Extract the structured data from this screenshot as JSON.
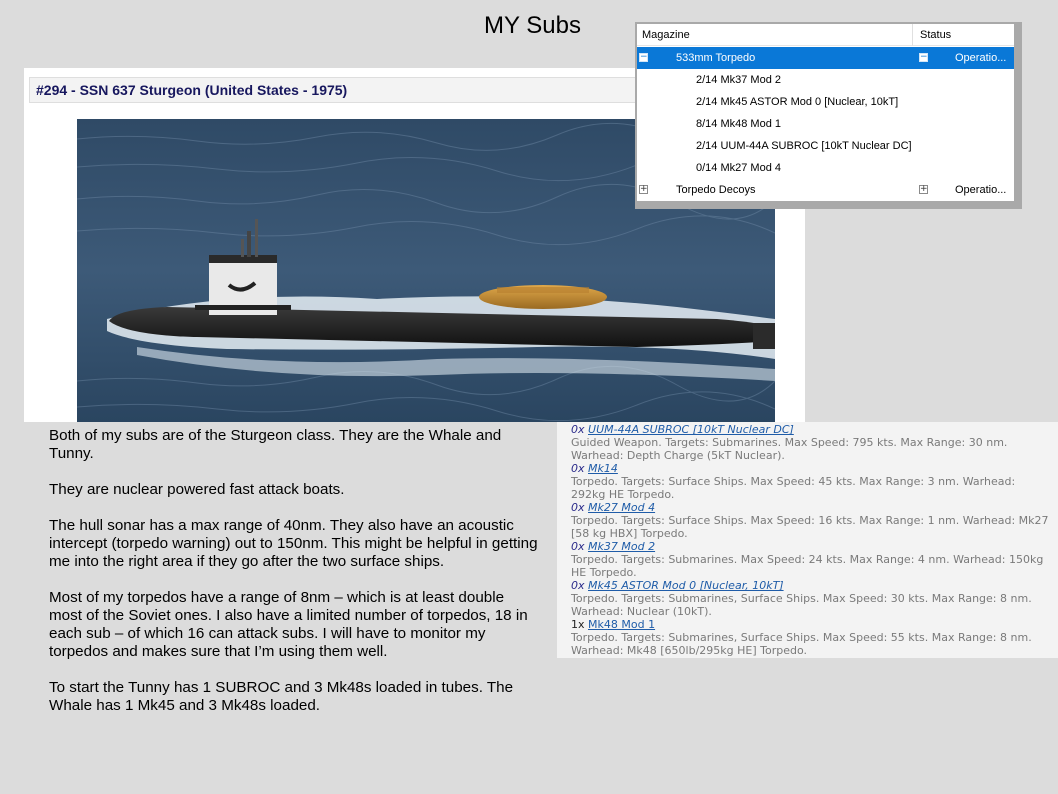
{
  "slide": {
    "title": "MY Subs"
  },
  "unit_card": {
    "header": "#294 - SSN 637 Sturgeon (United States - 1975)"
  },
  "magazine": {
    "columns": [
      "Magazine",
      "Status"
    ],
    "rows": [
      {
        "label": "533mm Torpedo",
        "status": "Operatio...",
        "expander": "−"
      },
      {
        "label": "2/14 Mk37 Mod 2"
      },
      {
        "label": "2/14 Mk45 ASTOR Mod 0 [Nuclear, 10kT]"
      },
      {
        "label": "8/14 Mk48 Mod 1"
      },
      {
        "label": "2/14 UUM-44A SUBROC [10kT Nuclear DC]"
      },
      {
        "label": "0/14 Mk27 Mod 4"
      },
      {
        "label": "Torpedo Decoys",
        "status": "Operatio...",
        "expander": "+"
      }
    ]
  },
  "body": {
    "paragraphs": [
      "Both of my subs are of the Sturgeon class.  They are the Whale and Tunny.",
      "They are nuclear powered fast attack boats.",
      "The hull sonar has a max range of 40nm.  They also have an acoustic intercept (torpedo warning) out to 150nm.  This might be helpful in getting me into the right area if they go after the two surface ships.",
      "Most of my torpedos have a range of 8nm – which is at least double most of the Soviet ones.  I also have a limited number of torpedos, 18 in each sub – of which 16 can attack subs.  I will have to monitor my torpedos and makes sure that I’m using them well.",
      "To start the Tunny has 1 SUBROC and 3 Mk48s loaded in tubes.  The Whale has 1 Mk45 and 3 Mk48s loaded."
    ]
  },
  "weapons": [
    {
      "count": "0x",
      "name": "UUM-44A SUBROC [10kT Nuclear DC]",
      "desc": "Guided Weapon. Targets: Submarines. Max Speed: 795 kts. Max Range: 30 nm. Warhead: Depth Charge (5kT Nuclear)."
    },
    {
      "count": "0x",
      "name": "Mk14",
      "desc": "Torpedo. Targets: Surface Ships. Max Speed: 45 kts. Max Range: 3 nm. Warhead: 292kg HE Torpedo."
    },
    {
      "count": "0x",
      "name": "Mk27 Mod 4",
      "desc": "Torpedo. Targets: Surface Ships. Max Speed: 16 kts. Max Range: 1 nm. Warhead: Mk27 [58 kg HBX] Torpedo."
    },
    {
      "count": "0x",
      "name": "Mk37 Mod 2",
      "desc": "Torpedo. Targets: Submarines. Max Speed: 24 kts. Max Range: 4 nm. Warhead: 150kg HE Torpedo."
    },
    {
      "count": "0x",
      "name": "Mk45 ASTOR Mod 0 [Nuclear, 10kT]",
      "desc": "Torpedo. Targets: Submarines, Surface Ships. Max Speed: 30 kts. Max Range: 8 nm. Warhead: Nuclear (10kT)."
    },
    {
      "count": "1x",
      "name": "Mk48 Mod 1",
      "desc": "Torpedo. Targets: Submarines, Surface Ships. Max Speed: 55 kts. Max Range: 8 nm. Warhead: Mk48 [650lb/295kg HE] Torpedo."
    }
  ]
}
